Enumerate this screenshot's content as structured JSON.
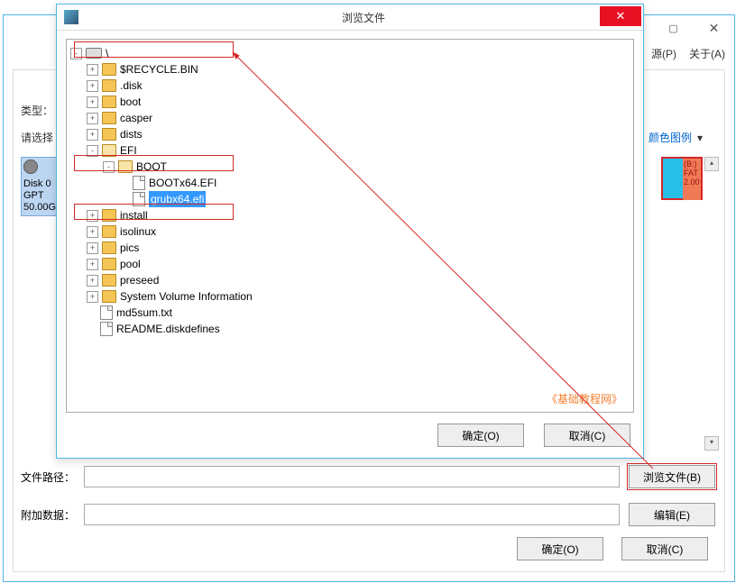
{
  "bg": {
    "menu_source": "源(P)",
    "menu_about": "关于(A)",
    "label_type": "类型：",
    "label_select": "请选择",
    "link_legend": "颜色图例",
    "disk_tile": {
      "l1": "Disk 0",
      "l2": "GPT",
      "l3": "50.00G"
    },
    "right_tile": {
      "a": "(B:)",
      "b": "FAT",
      "c": "2.00"
    },
    "label_path": "文件路径：",
    "label_extra": "附加数据：",
    "btn_browse": "浏览文件(B)",
    "btn_edit": "编辑(E)",
    "btn_ok": "确定(O)",
    "btn_cancel": "取消(C)"
  },
  "dlg": {
    "title": "浏览文件",
    "btn_ok": "确定(O)",
    "btn_cancel": "取消(C)",
    "watermark": "《基础教程网》",
    "root": "\\",
    "l1": [
      {
        "k": "recycle",
        "label": "$RECYCLE.BIN"
      },
      {
        "k": "disk",
        "label": ".disk"
      },
      {
        "k": "boot",
        "label": "boot"
      },
      {
        "k": "casper",
        "label": "casper"
      },
      {
        "k": "dists",
        "label": "dists"
      }
    ],
    "efi": "EFI",
    "bootdir": "BOOT",
    "bootfiles": [
      {
        "k": "bootx64",
        "label": "BOOTx64.EFI"
      },
      {
        "k": "grubx64",
        "label": "grubx64.efi"
      }
    ],
    "l1b": [
      {
        "k": "install",
        "label": "install"
      },
      {
        "k": "isolinux",
        "label": "isolinux"
      },
      {
        "k": "pics",
        "label": "pics"
      },
      {
        "k": "pool",
        "label": "pool"
      },
      {
        "k": "preseed",
        "label": "preseed"
      },
      {
        "k": "svi",
        "label": "System Volume Information"
      }
    ],
    "rootfiles": [
      {
        "k": "md5",
        "label": "md5sum.txt"
      },
      {
        "k": "readme",
        "label": "README.diskdefines"
      }
    ]
  }
}
